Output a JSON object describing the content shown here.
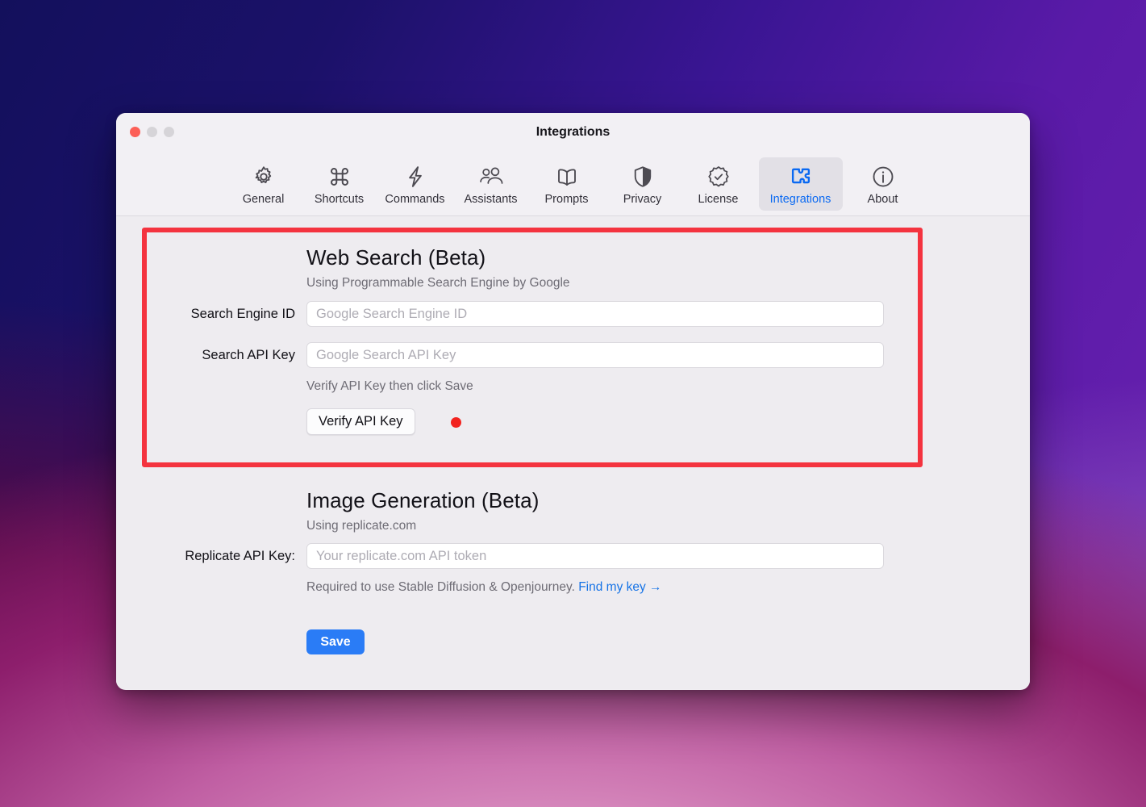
{
  "window": {
    "title": "Integrations",
    "traffic_lights": [
      {
        "name": "close",
        "color": "#fc5f57"
      },
      {
        "name": "minimize",
        "color": "#d6d4d8"
      },
      {
        "name": "zoom",
        "color": "#d6d4d8"
      }
    ]
  },
  "toolbar": {
    "selected": "Integrations",
    "accent_color": "#0a69f2",
    "tabs": [
      {
        "label": "General",
        "icon": "gear-icon"
      },
      {
        "label": "Shortcuts",
        "icon": "command-key-icon"
      },
      {
        "label": "Commands",
        "icon": "lightning-bolt-icon"
      },
      {
        "label": "Assistants",
        "icon": "people-icon"
      },
      {
        "label": "Prompts",
        "icon": "open-book-icon"
      },
      {
        "label": "Privacy",
        "icon": "shield-icon"
      },
      {
        "label": "License",
        "icon": "seal-checkmark-icon"
      },
      {
        "label": "Integrations",
        "icon": "puzzle-piece-icon"
      },
      {
        "label": "About",
        "icon": "info-circle-icon"
      }
    ]
  },
  "highlight": {
    "color": "#f4333f"
  },
  "web_search": {
    "heading": "Web Search (Beta)",
    "subheading": "Using Programmable Search Engine by Google",
    "engine_id_label": "Search Engine ID",
    "engine_id_value": "",
    "engine_id_placeholder": "Google Search Engine ID",
    "api_key_label": "Search API Key",
    "api_key_value": "",
    "api_key_placeholder": "Google Search API Key",
    "hint": "Verify API Key then click Save",
    "verify_button": "Verify API Key",
    "status_dot_color": "#f2231f"
  },
  "image_generation": {
    "heading": "Image Generation (Beta)",
    "subheading": "Using replicate.com",
    "api_key_label": "Replicate API Key:",
    "api_key_value": "",
    "api_key_placeholder": "Your replicate.com API token",
    "hint_text": "Required to use Stable Diffusion & Openjourney.",
    "link_text": "Find my key →"
  },
  "footer": {
    "save_label": "Save",
    "save_color": "#2a7cf6"
  }
}
